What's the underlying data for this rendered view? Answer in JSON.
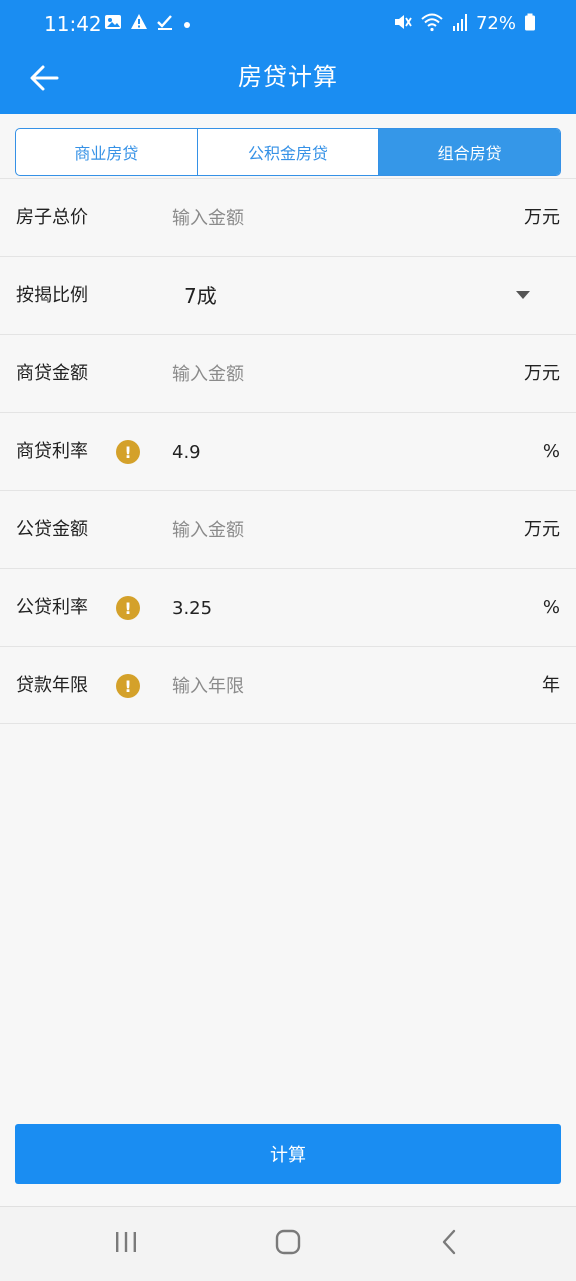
{
  "status_bar": {
    "time": "11:42",
    "battery": "72%",
    "icons": [
      "image-icon",
      "warning-icon",
      "check-icon",
      "dot-icon",
      "mute-icon",
      "wifi-icon",
      "signal-icon",
      "battery-icon"
    ]
  },
  "header": {
    "title": "房贷计算",
    "back_icon": "arrow-left-icon"
  },
  "tabs": [
    {
      "label": "商业房贷",
      "active": false
    },
    {
      "label": "公积金房贷",
      "active": false
    },
    {
      "label": "组合房贷",
      "active": true
    }
  ],
  "form": {
    "total_price": {
      "label": "房子总价",
      "placeholder": "输入金额",
      "value": "",
      "unit": "万元"
    },
    "ratio": {
      "label": "按揭比例",
      "value": "7成"
    },
    "commercial_amount": {
      "label": "商贷金额",
      "placeholder": "输入金额",
      "value": "",
      "unit": "万元"
    },
    "commercial_rate": {
      "label": "商贷利率",
      "value": "4.9",
      "unit": "%",
      "icon": "info-warning-icon"
    },
    "fund_amount": {
      "label": "公贷金额",
      "placeholder": "输入金额",
      "value": "",
      "unit": "万元"
    },
    "fund_rate": {
      "label": "公贷利率",
      "value": "3.25",
      "unit": "%",
      "icon": "info-warning-icon"
    },
    "term": {
      "label": "贷款年限",
      "placeholder": "输入年限",
      "value": "",
      "unit": "年",
      "icon": "info-warning-icon"
    }
  },
  "calculate_button": {
    "label": "计算"
  },
  "colors": {
    "primary": "#1a8df2",
    "tab_border": "#3591e6",
    "warning": "#d4a12a",
    "background": "#f7f7f7"
  },
  "nav_bar": {
    "icons": [
      "recent-apps-icon",
      "home-icon",
      "back-icon"
    ]
  }
}
